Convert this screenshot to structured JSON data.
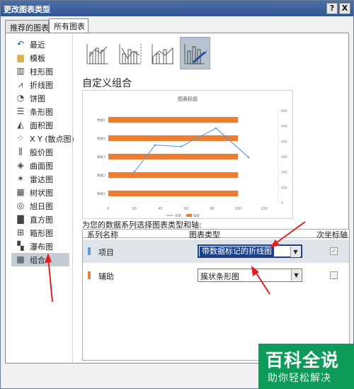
{
  "window": {
    "title": "更改图表类型",
    "help_label": "?",
    "close_label": "X"
  },
  "tabs": [
    {
      "label": "推荐的图表",
      "active": false
    },
    {
      "label": "所有图表",
      "active": true
    }
  ],
  "sidebar": {
    "items": [
      {
        "label": "最近",
        "icon": "undo-icon"
      },
      {
        "label": "模板",
        "icon": "folder-icon"
      },
      {
        "label": "柱形图",
        "icon": "column-chart-icon"
      },
      {
        "label": "折线图",
        "icon": "line-chart-icon"
      },
      {
        "label": "饼图",
        "icon": "pie-chart-icon"
      },
      {
        "label": "条形图",
        "icon": "bar-chart-icon"
      },
      {
        "label": "面积图",
        "icon": "area-chart-icon"
      },
      {
        "label": "X Y (散点图)",
        "icon": "scatter-chart-icon"
      },
      {
        "label": "股价图",
        "icon": "stock-chart-icon"
      },
      {
        "label": "曲面图",
        "icon": "surface-chart-icon"
      },
      {
        "label": "雷达图",
        "icon": "radar-chart-icon"
      },
      {
        "label": "树状图",
        "icon": "treemap-chart-icon"
      },
      {
        "label": "旭日图",
        "icon": "sunburst-chart-icon"
      },
      {
        "label": "直方图",
        "icon": "histogram-chart-icon"
      },
      {
        "label": "箱形图",
        "icon": "box-chart-icon"
      },
      {
        "label": "瀑布图",
        "icon": "waterfall-chart-icon"
      },
      {
        "label": "组合",
        "icon": "combo-chart-icon",
        "selected": true
      }
    ]
  },
  "section_title": "自定义组合",
  "chart_data": {
    "type": "bar",
    "title": "图表标题",
    "categories": [
      "数据1",
      "数据2",
      "数据3",
      "数据4",
      "数据5"
    ],
    "x_ticks": [
      "0",
      "20",
      "40",
      "60",
      "80",
      "100",
      "120"
    ],
    "right_ticks": [
      "0",
      "100",
      "200",
      "300",
      "400",
      "500",
      "600"
    ],
    "series": [
      {
        "name": "辅助",
        "type": "bar",
        "color": "#ed7d31",
        "values": [
          100,
          100,
          100,
          100,
          100
        ]
      },
      {
        "name": "项目",
        "type": "line",
        "color": "#5b9bd5",
        "points": [
          [
            20,
            200
          ],
          [
            36,
            375
          ],
          [
            56,
            365
          ],
          [
            83,
            485
          ],
          [
            108,
            295
          ]
        ]
      }
    ],
    "legend": [
      "项目",
      "辅助"
    ],
    "legend_position": "bottom",
    "xlim": [
      0,
      120
    ],
    "right_ylim": [
      0,
      600
    ]
  },
  "assign_label": "为您的数据系列选择图表类型和轴:",
  "grid": {
    "header": {
      "series_name": "系列名称",
      "chart_type": "图表类型",
      "secondary_axis": "次坐标轴"
    },
    "rows": [
      {
        "name": "项目",
        "color": "#5b9bd5",
        "chart_type": "带数据标记的折线图",
        "active": true,
        "secondary": true
      },
      {
        "name": "辅助",
        "color": "#ed7d31",
        "chart_type": "簇状条形图",
        "active": false,
        "secondary": false
      }
    ]
  },
  "watermark": {
    "line1": "百科全说",
    "line2": "助你轻松解决"
  }
}
